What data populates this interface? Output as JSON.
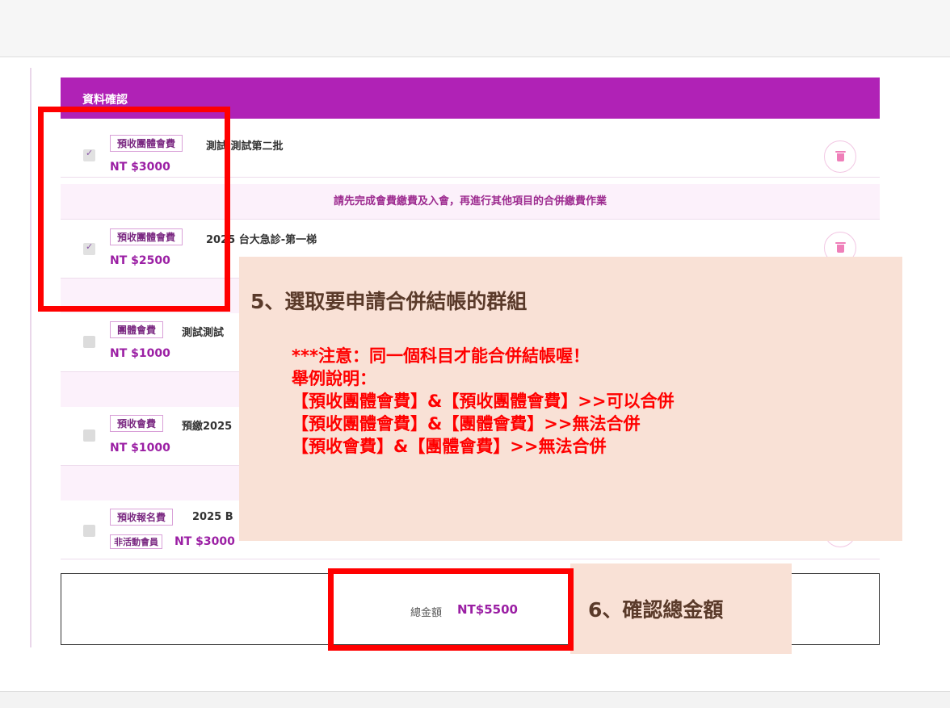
{
  "panel": {
    "title": "資料確認"
  },
  "items": [
    {
      "badge": "預收團體會費",
      "name": "測試 測試第二批",
      "price": "NT $3000",
      "checked": true
    },
    {
      "badge": "預收團體會費",
      "name": "2025 台大急診-第一梯",
      "price": "NT $2500",
      "checked": true
    },
    {
      "badge": "團體會費",
      "name": "測試測試",
      "price": "NT $1000",
      "checked": false
    },
    {
      "badge": "預收會費",
      "name": "預繳2025",
      "price": "NT $1000",
      "checked": false
    },
    {
      "badge": "預收報名費",
      "name": "2025 B",
      "price": "NT $3000",
      "sub_badge": "非活動會員",
      "checked": false
    }
  ],
  "notice": {
    "text": "請先完成會費繳費及入會，再進行其他項目的合併繳費作業"
  },
  "total": {
    "label": "總金額",
    "value": "NT$5500"
  },
  "annotation5": {
    "title": "5、選取要申請合併結帳的群組",
    "lines": [
      "***注意：同一個科目才能合併結帳喔！",
      "舉例說明：",
      "【預收團體會費】&【預收團體會費】>>可以合併",
      "【預收團體會費】&【團體會費】>>無法合併",
      "【預收會費】&【團體會費】>>無法合併"
    ]
  },
  "annotation6": {
    "title": "6、確認總金額"
  },
  "colors": {
    "header": "#b022b6",
    "price": "#9b1fa4",
    "notice_bg": "#fcf1fb",
    "highlight": "#ff0000",
    "callout_bg": "#f9e1d6"
  }
}
